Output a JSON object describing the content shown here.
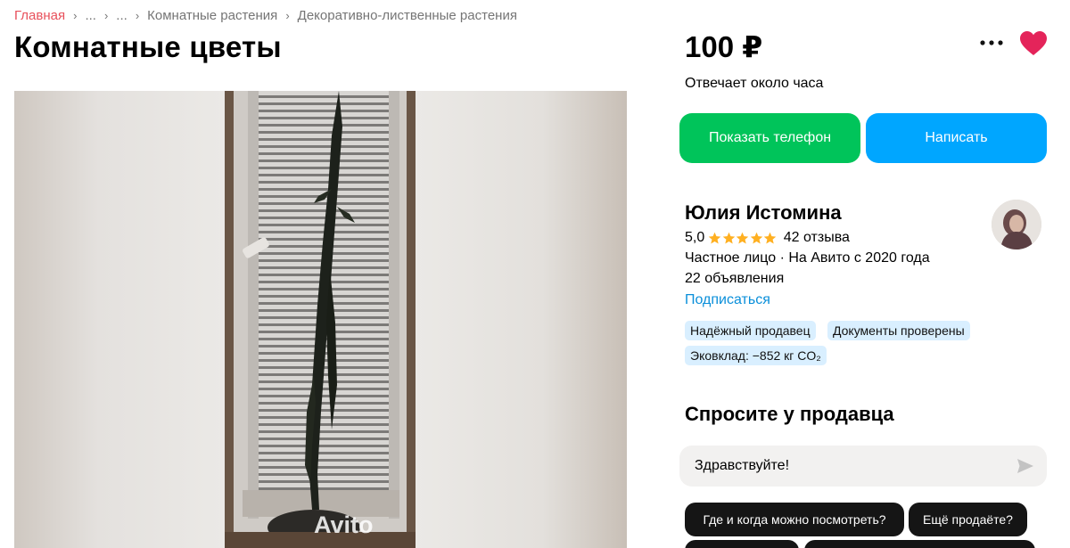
{
  "breadcrumb": {
    "items": [
      "Главная",
      "...",
      "...",
      "Комнатные растения",
      "Декоративно-лиственные растения"
    ],
    "home_color": "#e8505b"
  },
  "listing": {
    "title": "Комнатные цветы",
    "price": "100 ₽",
    "response_time": "Отвечает около часа"
  },
  "gallery": {
    "watermark": "Avito"
  },
  "actions": {
    "phone_label": "Показать телефон",
    "write_label": "Написать",
    "phone_color": "#00c45a",
    "write_color": "#00a6ff",
    "more_icon": "more-dots-icon",
    "favorite_icon": "heart-icon",
    "favorite_color": "#e4245a"
  },
  "seller": {
    "name": "Юлия Истомина",
    "rating": "5,0",
    "stars": 5,
    "reviews": "42 отзыва",
    "meta": "Частное лицо · На Авито с 2020 года",
    "ads": "22 объявления",
    "subscribe": "Подписаться",
    "badges": [
      "Надёжный продавец",
      "Документы проверены",
      "Эковклад: −852 кг CO₂"
    ]
  },
  "ask": {
    "title": "Спросите у продавца",
    "input_value": "Здравствуйте!",
    "send_icon": "send-icon",
    "quick_questions": [
      "Где и когда можно посмотреть?",
      "Ещё продаёте?",
      "",
      ""
    ]
  }
}
